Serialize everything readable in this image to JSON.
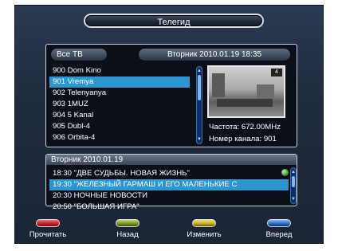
{
  "title": "Телегид",
  "group_label": "Все ТВ",
  "date_header": "Вторник  2010.01.19  18:35",
  "channels": [
    "900 Dom Kino",
    "901 Vremya",
    "902 Telenyanya",
    "903 1MUZ",
    "904 5 Kanal",
    "905 Dubl-4",
    "906 Orbita-4"
  ],
  "selected_channel_index": 1,
  "info": {
    "frequency": "Частота: 672.00MHz",
    "channel_number": "Номер канала: 901"
  },
  "epg": {
    "date": "Вторник  2010.01.19",
    "events": [
      "18:30 \"ДВЕ СУДЬБЫ. НОВАЯ ЖИЗНЬ\"",
      "19:30 \"ЖЕЛЕЗНЫЙ ГАРМАШ И ЕГО МАЛЕНЬКИЕ С",
      "20:30 НОЧНЫЕ НОВОСТИ",
      "20:50 \"БОЛЬШАЯ ИГРА\""
    ],
    "selected_event_index": 1
  },
  "buttons": [
    {
      "label": "Прочитать",
      "color": "#c8202b"
    },
    {
      "label": "Назад",
      "color": "#7a9a1c"
    },
    {
      "label": "Изменить",
      "color": "#c8b21e"
    },
    {
      "label": "Вперед",
      "color": "#2a6fd0"
    }
  ],
  "preview_badge": "4",
  "colors": {
    "selection": "#2a97d2",
    "panel_bg": "#0b0f18",
    "screen_bg": "#1f2b3e"
  }
}
